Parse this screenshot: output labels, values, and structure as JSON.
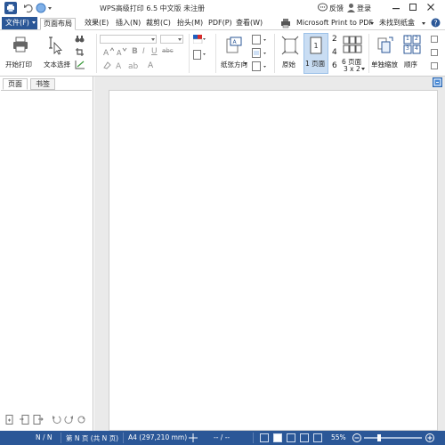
{
  "titlebar": {
    "title": "WPS高级打印 6.5 中文版 未注册",
    "feedback": "反馈",
    "login": "登录"
  },
  "menu": {
    "file": "文件(F)",
    "tabs": [
      {
        "label": "页面布局",
        "active": true
      },
      {
        "label": "效果(E)"
      },
      {
        "label": "插入(N)"
      },
      {
        "label": "裁剪(C)"
      },
      {
        "label": "抬头(M)"
      },
      {
        "label": "PDF(P)"
      },
      {
        "label": "查看(W)"
      }
    ],
    "printer": "Microsoft Print to PDF",
    "paper": "未找到纸盒"
  },
  "ribbon": {
    "start_print": "开始打印",
    "text_select": "文本选择",
    "orientation": "纸张方向",
    "original": "原始",
    "one_page": "1 页面",
    "n2": "2",
    "n4": "4",
    "n6": "6",
    "six_pages": "6 页面",
    "grid": "3 x 2",
    "replace_zoom": "单独缩放",
    "order": "顺序",
    "order_nums": [
      "1",
      "2",
      "3",
      "4"
    ]
  },
  "leftpanel": {
    "tab_page": "页面",
    "tab_bookmark": "书签"
  },
  "status": {
    "page_count": "N / N",
    "page_info": "第 N 页 (共 N 页)",
    "paper_size": "A4 (297,210 mm)",
    "position": "-- / --",
    "zoom": "55%"
  },
  "colors": {
    "accent": "#2b5797",
    "active_button": "#c9ddf3",
    "workspace": "#eaeaea"
  }
}
